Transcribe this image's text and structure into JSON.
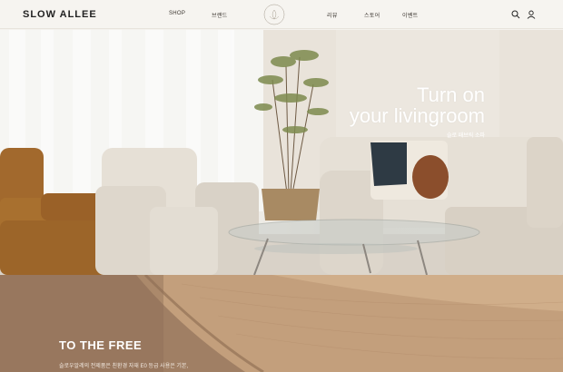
{
  "header": {
    "logo": "SLOW ALLEE",
    "nav": {
      "shop": "SHOP",
      "brand": "브랜드",
      "review": "리뷰",
      "store": "스토어",
      "event": "이벤트"
    },
    "emblem_text": "Slow Allee"
  },
  "hero": {
    "title_line1": "Turn on",
    "title_line2": "your livingroom",
    "subtitle": "슬로 패브릭 소파"
  },
  "section2": {
    "title": "TO THE FREE",
    "text": "슬로우알레의 전제품은 친환경 자재 E0 등급 사용은 기본,"
  },
  "colors": {
    "header_bg": "#f6f4f0",
    "hero_text": "#ffffff",
    "wood": "#b08b6b"
  }
}
